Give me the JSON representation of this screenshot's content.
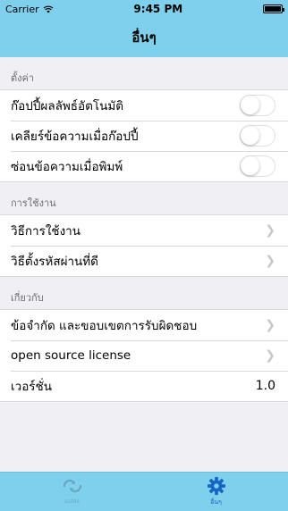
{
  "status_bar": {
    "carrier": "Carrier",
    "time": "9:45 PM"
  },
  "nav": {
    "title": "อื่นๆ"
  },
  "sections": [
    {
      "header": "ตั้งค่า",
      "rows": [
        {
          "label": "ก๊อปปี้ผลลัพธ์อัตโนมัติ",
          "toggle": false
        },
        {
          "label": "เคลียร์ข้อความเมื่อก๊อปปี้",
          "toggle": false
        },
        {
          "label": "ซ่อนข้อความเมื่อพิมพ์",
          "toggle": false
        }
      ]
    },
    {
      "header": "การใช้งาน",
      "rows": [
        {
          "label": "วิธีการใช้งาน"
        },
        {
          "label": "วิธีตั้งรหัสผ่านที่ดี"
        }
      ]
    },
    {
      "header": "เกี่ยวกับ",
      "rows": [
        {
          "label": "ข้อจำกัด และขอบเขตการรับผิดชอบ"
        },
        {
          "label": "open source license"
        },
        {
          "label": "เวอร์ชั่น",
          "value": "1.0"
        }
      ]
    }
  ],
  "tabbar": {
    "tabs": [
      {
        "label": "แปลง",
        "icon": "convert-icon",
        "active": false
      },
      {
        "label": "อื่นๆ",
        "icon": "gear-icon",
        "active": true
      }
    ]
  },
  "colors": {
    "bar": "#7fd0ec",
    "active_tab": "#1466c4",
    "background": "#efeff4"
  }
}
